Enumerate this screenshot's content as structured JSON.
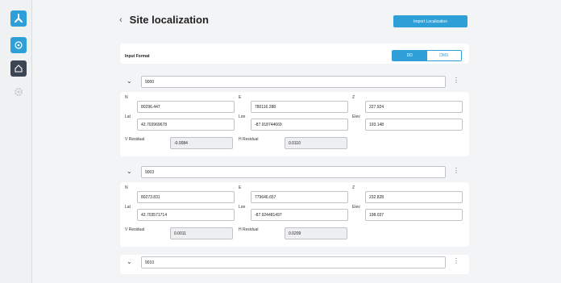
{
  "page": {
    "title": "Site localization",
    "back_icon": "‹",
    "import_button": "Import Localization"
  },
  "sidebar": {
    "items": [
      "logo",
      "target",
      "home",
      "settings"
    ]
  },
  "format": {
    "label": "Input Format",
    "options": [
      "DD",
      "DMS"
    ],
    "selected": "DD"
  },
  "labels": {
    "n": "N",
    "e": "E",
    "z": "Z",
    "lat": "Lat",
    "lon": "Lon",
    "elev": "Elev",
    "v_residual": "V Residual",
    "h_residual": "H Residual"
  },
  "points": [
    {
      "name": "9000",
      "n": "80296.447",
      "e": "780116.288",
      "z": "227.924",
      "lat": "42.703969678",
      "lon": "-87.918744669",
      "elev": "193.148",
      "v_residual": "-0.0084",
      "h_residual": "0.0110"
    },
    {
      "name": "9003",
      "n": "80273.831",
      "e": "779646.657",
      "z": "232.828",
      "lat": "42.703571714",
      "lon": "-87.924481497",
      "elev": "198.037",
      "v_residual": "0.0011",
      "h_residual": "0.0209"
    },
    {
      "name": "9010"
    }
  ]
}
